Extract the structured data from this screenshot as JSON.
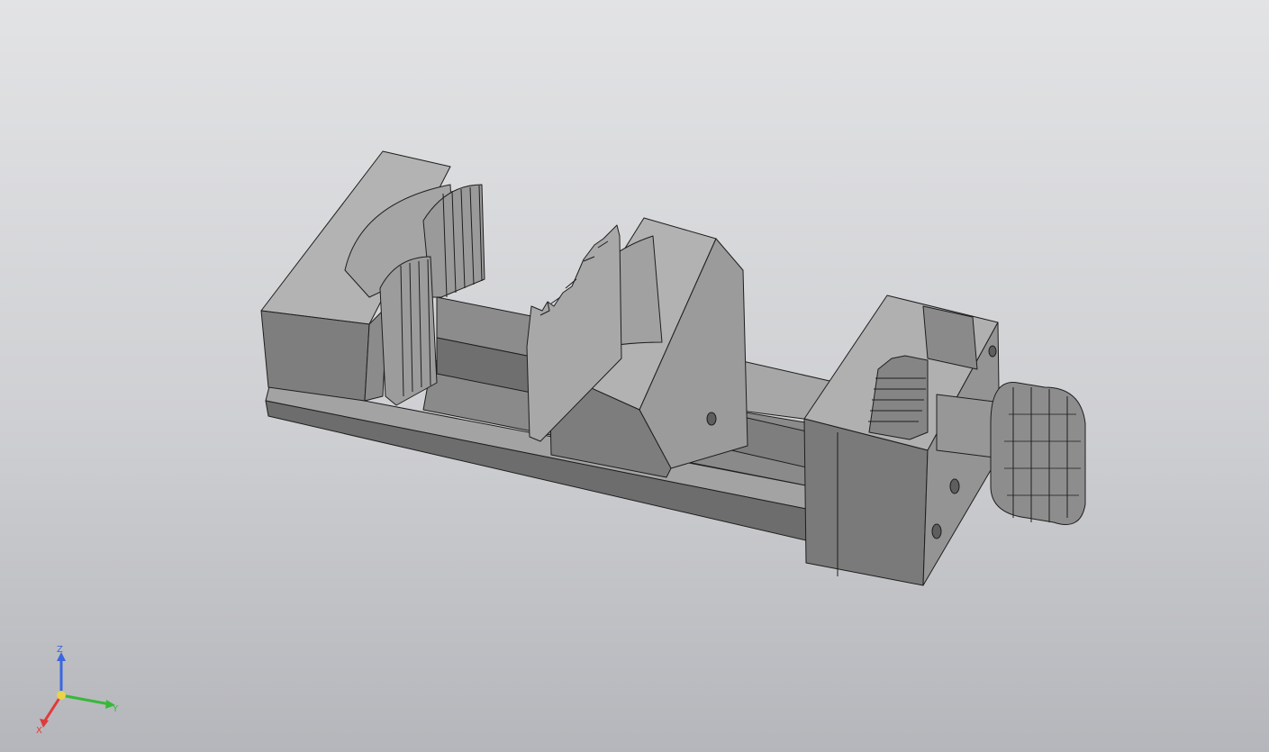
{
  "viewport": {
    "background_top": "#e2e3e5",
    "background_bottom": "#b5b6bb"
  },
  "model": {
    "fill_light": "#a9a9a9",
    "fill_mid": "#8f8f8f",
    "fill_dark": "#767676",
    "fill_deep": "#636363",
    "edge_color": "#1e1e1e"
  },
  "axis_triad": {
    "x_label": "X",
    "y_label": "Y",
    "z_label": "Z",
    "x_color": "#e03a3a",
    "y_color": "#38b838",
    "z_color": "#3a66e0",
    "origin_color": "#e8d44a"
  }
}
